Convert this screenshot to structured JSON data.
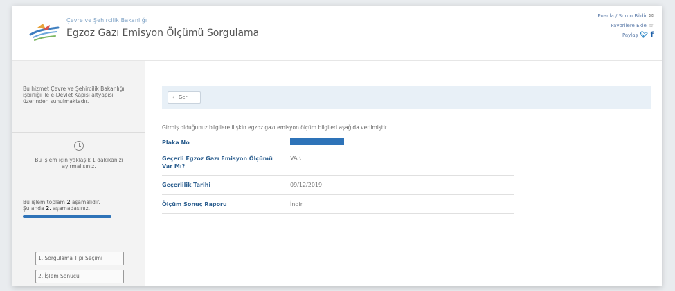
{
  "header": {
    "ministry": "Çevre ve Şehircilik Bakanlığı",
    "title": "Egzoz Gazı Emisyon Ölçümü Sorgulama",
    "links": {
      "feedback": "Puanla / Sorun Bildir",
      "favorites": "Favorilere Ekle",
      "share": "Paylaş"
    }
  },
  "sidebar": {
    "description": "Bu hizmet Çevre ve Şehircilik Bakanlığı işbirliği ile e-Devlet Kapısı altyapısı üzerinden sunulmaktadır.",
    "time_text": "Bu işlem için yaklaşık 1 dakikanızı ayırmalısınız.",
    "steps": {
      "total_prefix": "Bu işlem toplam ",
      "total": "2",
      "total_suffix": " aşamalıdır.",
      "current_prefix": "Şu anda ",
      "current": "2.",
      "current_suffix": " aşamadasınız.",
      "progress": 1.0
    },
    "nav": [
      {
        "label": "1. Sorgulama Tipi Seçimi"
      },
      {
        "label": "2. İşlem Sonucu"
      }
    ]
  },
  "main": {
    "back_label": "Geri",
    "intro": "Girmiş olduğunuz bilgilere ilişkin egzoz gazı emisyon ölçüm bilgileri aşağıda verilmiştir.",
    "rows": [
      {
        "label": "Plaka No",
        "value": ""
      },
      {
        "label": "Geçerli Egzoz Gazı Emisyon Ölçümü Var Mı?",
        "value": "VAR"
      },
      {
        "label": "Geçerlilik Tarihi",
        "value": "09/12/2019"
      },
      {
        "label": "Ölçüm Sonuç Raporu",
        "value": "İndir"
      }
    ]
  },
  "colors": {
    "accent": "#2e73b8",
    "label": "#2d5f8f",
    "toolbar_bg": "#e8f0f7"
  }
}
